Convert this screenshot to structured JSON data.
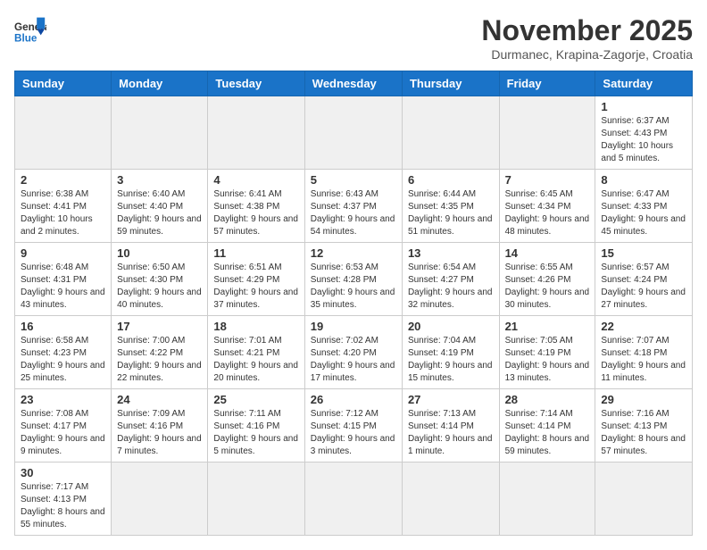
{
  "logo": {
    "text_general": "General",
    "text_blue": "Blue"
  },
  "title": "November 2025",
  "subtitle": "Durmanec, Krapina-Zagorje, Croatia",
  "weekdays": [
    "Sunday",
    "Monday",
    "Tuesday",
    "Wednesday",
    "Thursday",
    "Friday",
    "Saturday"
  ],
  "weeks": [
    [
      {
        "day": "",
        "info": ""
      },
      {
        "day": "",
        "info": ""
      },
      {
        "day": "",
        "info": ""
      },
      {
        "day": "",
        "info": ""
      },
      {
        "day": "",
        "info": ""
      },
      {
        "day": "",
        "info": ""
      },
      {
        "day": "1",
        "info": "Sunrise: 6:37 AM\nSunset: 4:43 PM\nDaylight: 10 hours and 5 minutes."
      }
    ],
    [
      {
        "day": "2",
        "info": "Sunrise: 6:38 AM\nSunset: 4:41 PM\nDaylight: 10 hours and 2 minutes."
      },
      {
        "day": "3",
        "info": "Sunrise: 6:40 AM\nSunset: 4:40 PM\nDaylight: 9 hours and 59 minutes."
      },
      {
        "day": "4",
        "info": "Sunrise: 6:41 AM\nSunset: 4:38 PM\nDaylight: 9 hours and 57 minutes."
      },
      {
        "day": "5",
        "info": "Sunrise: 6:43 AM\nSunset: 4:37 PM\nDaylight: 9 hours and 54 minutes."
      },
      {
        "day": "6",
        "info": "Sunrise: 6:44 AM\nSunset: 4:35 PM\nDaylight: 9 hours and 51 minutes."
      },
      {
        "day": "7",
        "info": "Sunrise: 6:45 AM\nSunset: 4:34 PM\nDaylight: 9 hours and 48 minutes."
      },
      {
        "day": "8",
        "info": "Sunrise: 6:47 AM\nSunset: 4:33 PM\nDaylight: 9 hours and 45 minutes."
      }
    ],
    [
      {
        "day": "9",
        "info": "Sunrise: 6:48 AM\nSunset: 4:31 PM\nDaylight: 9 hours and 43 minutes."
      },
      {
        "day": "10",
        "info": "Sunrise: 6:50 AM\nSunset: 4:30 PM\nDaylight: 9 hours and 40 minutes."
      },
      {
        "day": "11",
        "info": "Sunrise: 6:51 AM\nSunset: 4:29 PM\nDaylight: 9 hours and 37 minutes."
      },
      {
        "day": "12",
        "info": "Sunrise: 6:53 AM\nSunset: 4:28 PM\nDaylight: 9 hours and 35 minutes."
      },
      {
        "day": "13",
        "info": "Sunrise: 6:54 AM\nSunset: 4:27 PM\nDaylight: 9 hours and 32 minutes."
      },
      {
        "day": "14",
        "info": "Sunrise: 6:55 AM\nSunset: 4:26 PM\nDaylight: 9 hours and 30 minutes."
      },
      {
        "day": "15",
        "info": "Sunrise: 6:57 AM\nSunset: 4:24 PM\nDaylight: 9 hours and 27 minutes."
      }
    ],
    [
      {
        "day": "16",
        "info": "Sunrise: 6:58 AM\nSunset: 4:23 PM\nDaylight: 9 hours and 25 minutes."
      },
      {
        "day": "17",
        "info": "Sunrise: 7:00 AM\nSunset: 4:22 PM\nDaylight: 9 hours and 22 minutes."
      },
      {
        "day": "18",
        "info": "Sunrise: 7:01 AM\nSunset: 4:21 PM\nDaylight: 9 hours and 20 minutes."
      },
      {
        "day": "19",
        "info": "Sunrise: 7:02 AM\nSunset: 4:20 PM\nDaylight: 9 hours and 17 minutes."
      },
      {
        "day": "20",
        "info": "Sunrise: 7:04 AM\nSunset: 4:19 PM\nDaylight: 9 hours and 15 minutes."
      },
      {
        "day": "21",
        "info": "Sunrise: 7:05 AM\nSunset: 4:19 PM\nDaylight: 9 hours and 13 minutes."
      },
      {
        "day": "22",
        "info": "Sunrise: 7:07 AM\nSunset: 4:18 PM\nDaylight: 9 hours and 11 minutes."
      }
    ],
    [
      {
        "day": "23",
        "info": "Sunrise: 7:08 AM\nSunset: 4:17 PM\nDaylight: 9 hours and 9 minutes."
      },
      {
        "day": "24",
        "info": "Sunrise: 7:09 AM\nSunset: 4:16 PM\nDaylight: 9 hours and 7 minutes."
      },
      {
        "day": "25",
        "info": "Sunrise: 7:11 AM\nSunset: 4:16 PM\nDaylight: 9 hours and 5 minutes."
      },
      {
        "day": "26",
        "info": "Sunrise: 7:12 AM\nSunset: 4:15 PM\nDaylight: 9 hours and 3 minutes."
      },
      {
        "day": "27",
        "info": "Sunrise: 7:13 AM\nSunset: 4:14 PM\nDaylight: 9 hours and 1 minute."
      },
      {
        "day": "28",
        "info": "Sunrise: 7:14 AM\nSunset: 4:14 PM\nDaylight: 8 hours and 59 minutes."
      },
      {
        "day": "29",
        "info": "Sunrise: 7:16 AM\nSunset: 4:13 PM\nDaylight: 8 hours and 57 minutes."
      }
    ],
    [
      {
        "day": "30",
        "info": "Sunrise: 7:17 AM\nSunset: 4:13 PM\nDaylight: 8 hours and 55 minutes."
      },
      {
        "day": "",
        "info": ""
      },
      {
        "day": "",
        "info": ""
      },
      {
        "day": "",
        "info": ""
      },
      {
        "day": "",
        "info": ""
      },
      {
        "day": "",
        "info": ""
      },
      {
        "day": "",
        "info": ""
      }
    ]
  ]
}
